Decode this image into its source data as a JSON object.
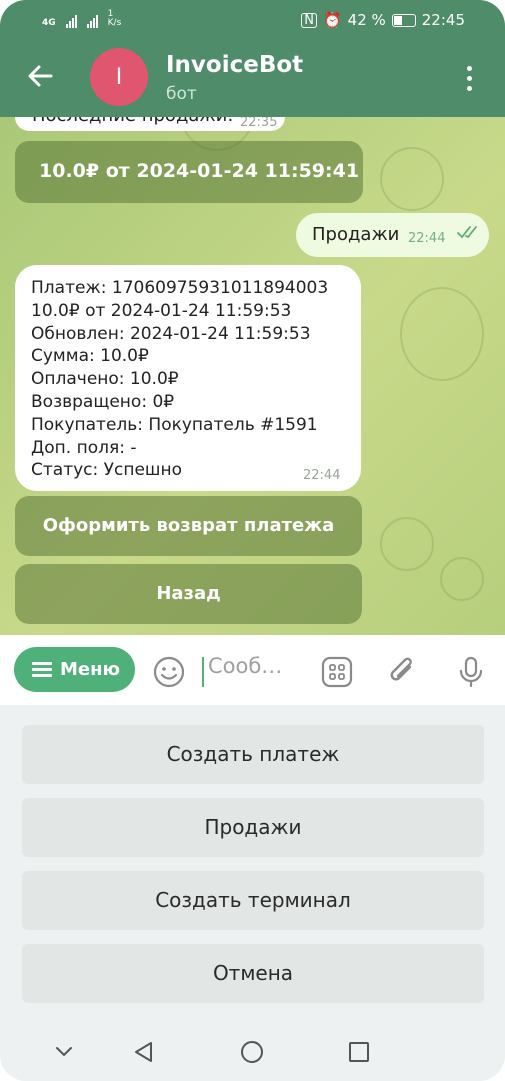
{
  "status_bar": {
    "network_1": "4G",
    "speed": "1",
    "speed_unit": "K/s",
    "battery": "42 %",
    "time": "22:45"
  },
  "header": {
    "avatar_letter": "I",
    "title": "InvoiceBot",
    "subtitle": "бот"
  },
  "messages": {
    "cut_text": "Последние продажи:",
    "cut_time": "22:35",
    "sale_line": "10.0₽ от 2024-01-24 11:59:41",
    "outgoing_text": "Продажи",
    "outgoing_time": "22:44",
    "incoming_lines": [
      "Платеж: 17060975931011894003",
      "10.0₽ от 2024-01-24 11:59:53",
      "Обновлен: 2024-01-24  11:59:53",
      "Сумма: 10.0₽",
      "Оплачено: 10.0₽",
      "Возвращено: 0₽",
      "Покупатель: Покупатель  #1591",
      "Доп. поля: -",
      "Статус: Успешно"
    ],
    "incoming_time": "22:44"
  },
  "inline_buttons": {
    "refund": "Оформить возврат платежа",
    "back": "Назад"
  },
  "input_bar": {
    "menu_label": "Меню",
    "placeholder": "Сооб…"
  },
  "keyboard": {
    "create_payment": "Создать платеж",
    "sales": "Продажи",
    "create_terminal": "Создать терминал",
    "cancel": "Отмена"
  },
  "colors": {
    "header": "#4e8c6a",
    "accent": "#4fb07a",
    "avatar": "#e0566f"
  }
}
